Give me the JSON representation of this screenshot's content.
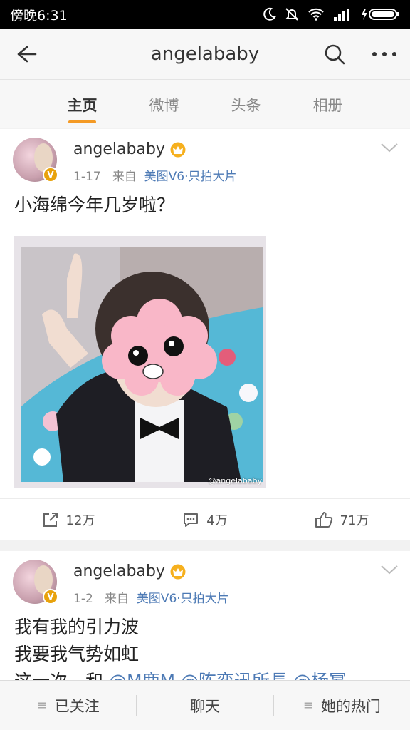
{
  "status_bar": {
    "time": "傍晚6:31"
  },
  "nav": {
    "title": "angelababy"
  },
  "tabs": [
    {
      "label": "主页",
      "active": true
    },
    {
      "label": "微博",
      "active": false
    },
    {
      "label": "头条",
      "active": false
    },
    {
      "label": "相册",
      "active": false
    }
  ],
  "posts": [
    {
      "author": "angelababy",
      "date": "1-17",
      "from_label": "来自",
      "source": "美图V6·只拍大片",
      "verified_badge": "V",
      "text": "小海绵今年几岁啦？",
      "image_watermark": "@angelababy",
      "reposts": "12万",
      "comments": "4万",
      "likes": "71万"
    },
    {
      "author": "angelababy",
      "date": "1-2",
      "from_label": "来自",
      "source": "美图V6·只拍大片",
      "verified_badge": "V",
      "lines": [
        "我有我的引力波",
        "我要我气势如虹"
      ],
      "line3_prefix": "这一次，和",
      "mention": "@M鹿M @陈奕迅所長 @杨幂"
    }
  ],
  "bottom_bar": {
    "follow": "已关注",
    "chat": "聊天",
    "hot": "她的热门"
  },
  "colors": {
    "accent": "#f49a25",
    "link": "#4d7ab5",
    "badge": "#e8a20c"
  }
}
